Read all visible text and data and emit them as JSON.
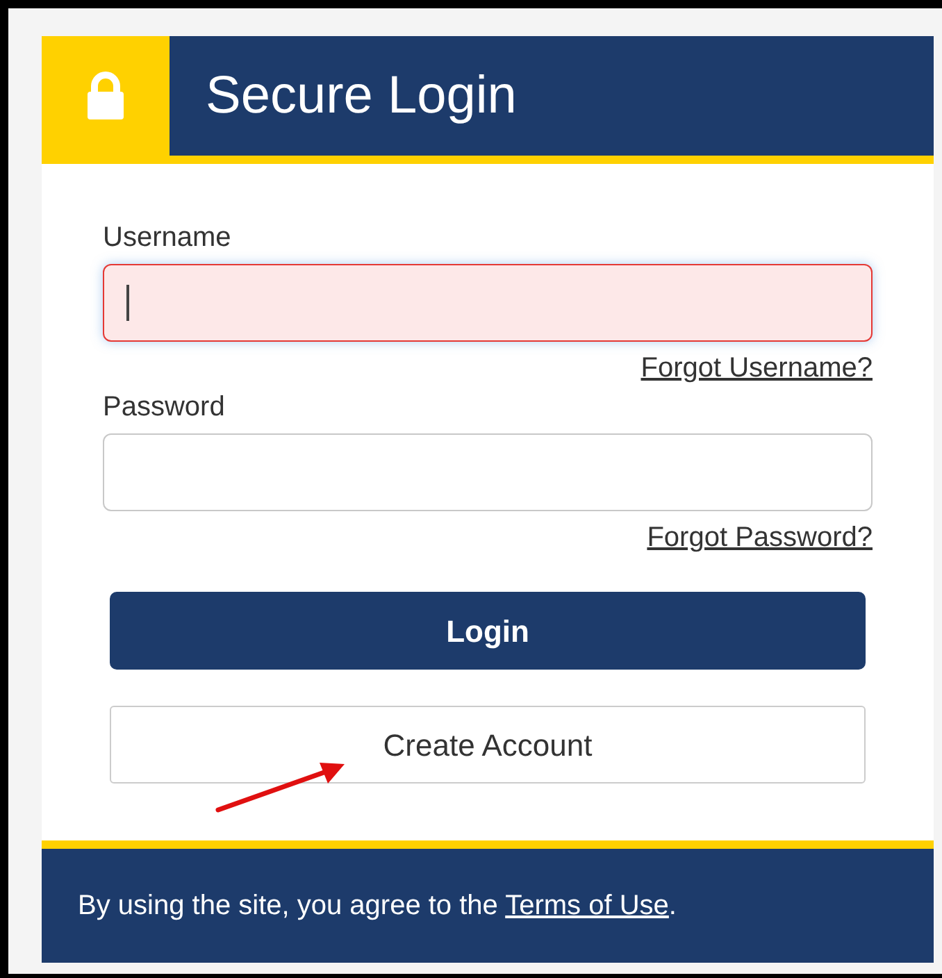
{
  "header": {
    "title": "Secure Login"
  },
  "fields": [
    {
      "label": "Username",
      "error": true,
      "focused": true,
      "link": "Forgot Username?"
    },
    {
      "label": "Password",
      "error": false,
      "focused": false,
      "link": "Forgot Password?"
    }
  ],
  "buttons": [
    {
      "label": "Login",
      "kind": "primary"
    },
    {
      "label": "Create Account",
      "kind": "secondary"
    }
  ],
  "footer": {
    "text_before": "By using the site, you agree to the ",
    "link": "Terms of Use",
    "text_after": "."
  }
}
